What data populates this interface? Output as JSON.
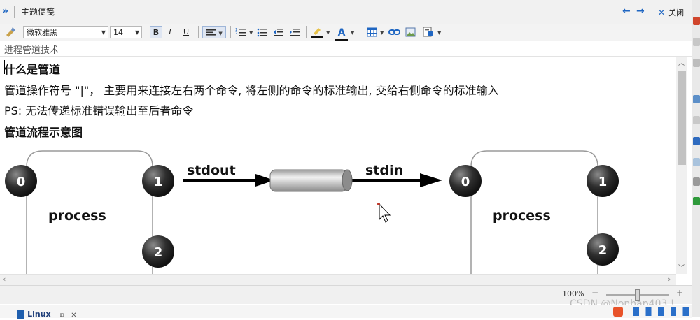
{
  "titlebar": {
    "expand_icon": "double-chevron-right",
    "title": "主题便笺",
    "close_label": "关闭"
  },
  "toolbar": {
    "font_family": "微软雅黑",
    "font_size": "14",
    "bold": "B",
    "italic": "I",
    "underline": "U",
    "font_color_letter": "A"
  },
  "subject": "进程管道技术",
  "content": {
    "heading1": "什么是管道",
    "para1": "管道操作符号 \"|\"， 主要用来连接左右两个命令, 将左侧的命令的标准输出, 交给右侧命令的标准输入",
    "para2": "PS: 无法传递标准错误输出至后者命令",
    "heading2": "管道流程示意图"
  },
  "diagram": {
    "left_fd_0": "0",
    "left_fd_1": "1",
    "left_fd_2": "2",
    "left_process": "process",
    "stdout_label": "stdout",
    "stdin_label": "stdin",
    "right_fd_0": "0",
    "right_fd_1": "1",
    "right_fd_2": "2",
    "right_process": "process"
  },
  "status": {
    "zoom": "100%",
    "minus": "−",
    "plus": "+"
  },
  "bottom": {
    "tab_label": "Linux"
  },
  "watermark": "CSDN @Nonhap403 !",
  "colors": {
    "accent_blue": "#1f66c2",
    "close_red": "#1f66c2"
  }
}
